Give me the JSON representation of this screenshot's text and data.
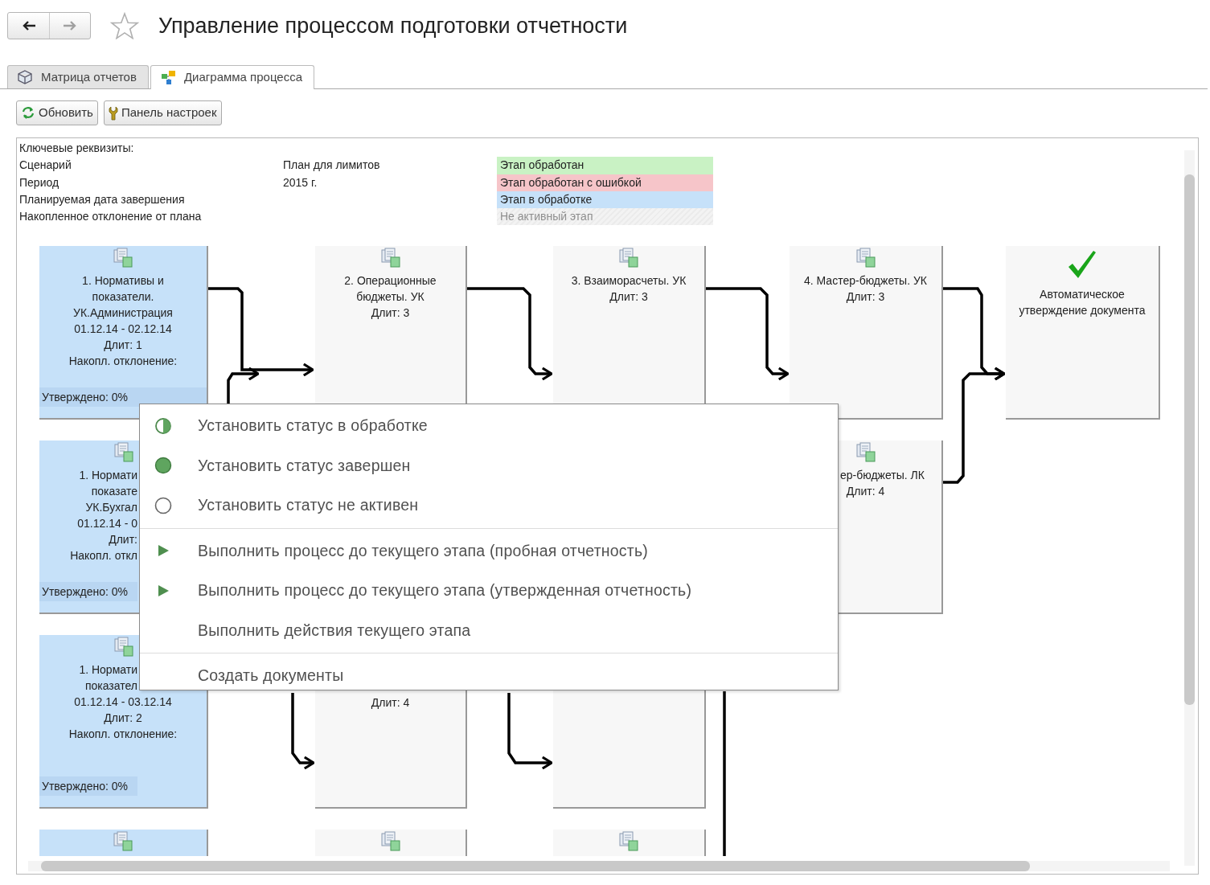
{
  "window": {
    "title": "Управление процессом подготовки отчетности",
    "favorite": false,
    "nav": [
      {
        "kind": "back",
        "disabled": false
      },
      {
        "kind": "forward",
        "disabled": true
      }
    ]
  },
  "tabs": [
    {
      "label": "Матрица отчетов",
      "selected": false
    },
    {
      "label": "Диаграмма процесса",
      "selected": true
    }
  ],
  "toolbar": [
    {
      "label": "Обновить"
    },
    {
      "label": "Панель настроек"
    }
  ],
  "attributes": {
    "heading": "Ключевые реквизиты:",
    "rows": [
      {
        "label": "Сценарий",
        "value": "План для лимитов"
      },
      {
        "label": "Период",
        "value": "2015 г."
      },
      {
        "label": "Планируемая дата завершения"
      },
      {
        "label": "Накопленное отклонение от плана"
      }
    ]
  },
  "legend": [
    {
      "label": "Этап обработан",
      "color": "#c9f2c4",
      "muted": false
    },
    {
      "label": "Этап обработан с ошибкой",
      "color": "#f6c5c9",
      "muted": false
    },
    {
      "label": "Этап в обработке",
      "color": "#c6e1f9",
      "muted": false
    },
    {
      "label": "Не активный этап",
      "color": "#f3f3f3",
      "muted": true
    }
  ],
  "diagram": {
    "rows": [
      [
        {
          "kind": "stage",
          "in_progress": true,
          "lines": [
            "1. Нормативы и",
            "показатели.",
            "УК.Администрация",
            "01.12.14 - 02.12.14",
            "Длит: 1",
            "Накопл. отклонение:"
          ],
          "footer": "Утверждено: 0%"
        },
        {
          "kind": "stage",
          "in_progress": false,
          "lines": [
            "2. Операционные",
            "бюджеты. УК",
            "Длит: 3"
          ]
        },
        {
          "kind": "stage",
          "in_progress": false,
          "lines": [
            "3. Взаиморасчеты. УК",
            "Длит: 3"
          ]
        },
        {
          "kind": "stage",
          "in_progress": false,
          "lines": [
            "4. Мастер-бюджеты. УК",
            "Длит: 3"
          ]
        },
        {
          "kind": "approval",
          "in_progress": false,
          "lines": [
            "Автоматическое",
            "утверждение документа"
          ]
        }
      ],
      [
        {
          "kind": "stage",
          "in_progress": true,
          "lines_cut_at_right": [
            "1. Нормати",
            "показате",
            "УК.Бухгал",
            "01.12.14 - 0",
            "Длит:",
            "Накопл. откл"
          ],
          "footer": "Утверждено: 0%"
        },
        "",
        "",
        {
          "kind": "stage",
          "in_progress": false,
          "lines_cut_at_left": [
            "ер-бюджеты. ЛК"
          ],
          "lines": [
            "Длит: 4"
          ]
        }
      ],
      [
        {
          "kind": "stage",
          "in_progress": true,
          "lines_cut_at_right": [
            "1. Нормати",
            "показател"
          ],
          "lines": [
            "01.12.14 - 03.12.14",
            "Длит: 2",
            "Накопл. отклонение:"
          ],
          "footer": "Утверждено: 0%"
        },
        {
          "kind": "stage",
          "in_progress": false,
          "lines": [
            "Длит: 4"
          ]
        },
        {
          "kind": "stage",
          "in_progress": false
        }
      ],
      [
        {
          "kind": "stage",
          "in_progress": true
        },
        {
          "kind": "stage",
          "in_progress": false
        },
        {
          "kind": "stage",
          "in_progress": false
        }
      ]
    ]
  },
  "context_menu": {
    "groups": [
      [
        {
          "label": "Установить статус в обработке"
        },
        {
          "label": "Установить статус завершен"
        },
        {
          "label": "Установить статус не активен"
        }
      ],
      [
        {
          "label": "Выполнить процесс до текущего этапа (пробная отчетность)"
        },
        {
          "label": "Выполнить процесс до текущего этапа (утвержденная отчетность)"
        },
        {
          "label": "Выполнить действия текущего этапа"
        }
      ],
      [
        {
          "label": "Создать документы"
        }
      ]
    ]
  }
}
